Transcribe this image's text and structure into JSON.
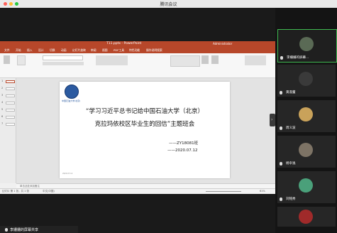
{
  "window": {
    "title": "腾讯会议"
  },
  "ppt": {
    "title": "T11.pptx - PowerPoint",
    "user": "Administrator",
    "tabs": [
      "文件",
      "开始",
      "插入",
      "设计",
      "切换",
      "动画",
      "幻灯片放映",
      "审阅",
      "视图",
      "PDF工具",
      "特色功能",
      "操作说明搜索"
    ],
    "thumb_numbers": [
      "1",
      "2",
      "3",
      "4",
      "5",
      "6",
      "7"
    ],
    "notes_hint": "单击此处添加备注",
    "status_left": "幻灯片 第 1 张，共 1 张",
    "status_lang": "中文(中国)",
    "zoom": "61%"
  },
  "slide": {
    "logo_text": "中国石油大学(北京)",
    "line1": "“学习习近平总书记给中国石油大学（北京）",
    "line2": "克拉玛依校区毕业生的回信”主题班会",
    "class": "——ZY18081班",
    "date": "——2020.07.12",
    "footer": "2020.07.12"
  },
  "sidebar": {
    "tiles": [
      {
        "name": "李姗姗的屏幕...",
        "avatar_color": "#5a6a55",
        "active": true
      },
      {
        "name": "黄淑董",
        "avatar_color": "#3a3a3a"
      },
      {
        "name": "周义波",
        "avatar_color": "#c9a25a"
      },
      {
        "name": "杨幸逸",
        "avatar_color": "#7d7365"
      },
      {
        "name": "刘铭秀",
        "avatar_color": "#4aa07a"
      }
    ]
  },
  "bottom": {
    "share_label": "李姗姗的屏幕共享"
  }
}
